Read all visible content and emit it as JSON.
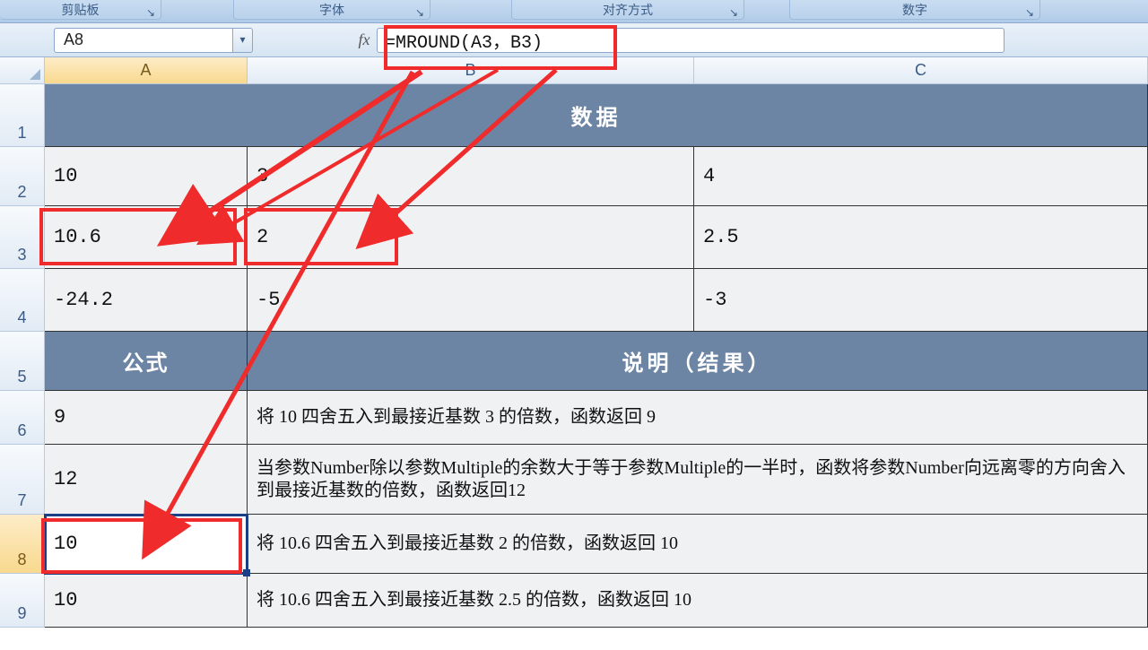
{
  "ribbon": {
    "groups": {
      "clipboard": "剪贴板",
      "font": "字体",
      "alignment": "对齐方式",
      "number": "数字"
    }
  },
  "namebox": {
    "cell_ref": "A8"
  },
  "formula_bar": {
    "fx_label": "fx",
    "formula": "=MROUND(A3，B3)"
  },
  "columns": {
    "A": "A",
    "B": "B",
    "C": "C"
  },
  "row_numbers": [
    "1",
    "2",
    "3",
    "4",
    "5",
    "6",
    "7",
    "8",
    "9"
  ],
  "sheet": {
    "header_data": "数据",
    "r2": {
      "a": "10",
      "b": "3",
      "c": "4"
    },
    "r3": {
      "a": "10.6",
      "b": "2",
      "c": "2.5"
    },
    "r4": {
      "a": "-24.2",
      "b": "-5",
      "c": "-3"
    },
    "header_formula": "公式",
    "header_desc": "说明（结果）",
    "r6": {
      "a": "9",
      "bc": "将 10 四舍五入到最接近基数 3 的倍数，函数返回 9"
    },
    "r7": {
      "a": "12",
      "bc": "当参数Number除以参数Multiple的余数大于等于参数Multiple的一半时，函数将参数Number向远离零的方向舍入到最接近基数的倍数，函数返回12"
    },
    "r8": {
      "a": "10",
      "bc": "将 10.6 四舍五入到最接近基数 2 的倍数，函数返回 10"
    },
    "r9": {
      "a": "10",
      "bc": "将 10.6 四舍五入到最接近基数 2.5 的倍数，函数返回 10"
    }
  },
  "icons": {
    "dropdown": "▾",
    "launcher": "↘"
  }
}
